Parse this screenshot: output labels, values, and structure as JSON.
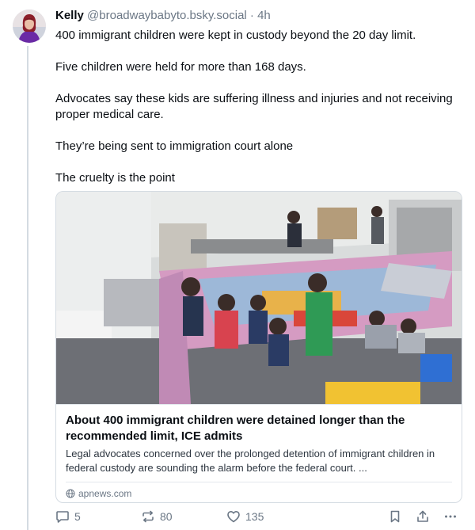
{
  "author": {
    "name": "Kelly",
    "handle": "@broadwaybabyto.bsky.social",
    "separator": "·",
    "time": "4h"
  },
  "post": {
    "paragraphs": [
      "400 immigrant children were kept in custody beyond the 20 day limit.",
      "Five children were held for more than 168 days.",
      "Advocates say these kids are suffering illness and injuries and not receiving proper medical care.",
      "They’re being sent to immigration court alone",
      "The cruelty is the point"
    ]
  },
  "card": {
    "title": "About 400 immigrant children were detained longer than the recommended limit, ICE admits",
    "description": "Legal advocates concerned over the prolonged detention of immigrant children in federal custody are sounding the alarm before the federal court. ...",
    "domain": "apnews.com"
  },
  "actions": {
    "replies": "5",
    "reposts": "80",
    "likes": "135"
  },
  "icons": {
    "domain": "globe-icon",
    "reply": "speech-bubble-icon",
    "repost": "repost-arrows-icon",
    "like": "heart-icon",
    "bookmark": "bookmark-icon",
    "share": "share-icon",
    "more": "more-dots-icon"
  },
  "colors": {
    "muted": "#6b7785",
    "border": "#d4dbe2",
    "text": "#0b0f14"
  }
}
